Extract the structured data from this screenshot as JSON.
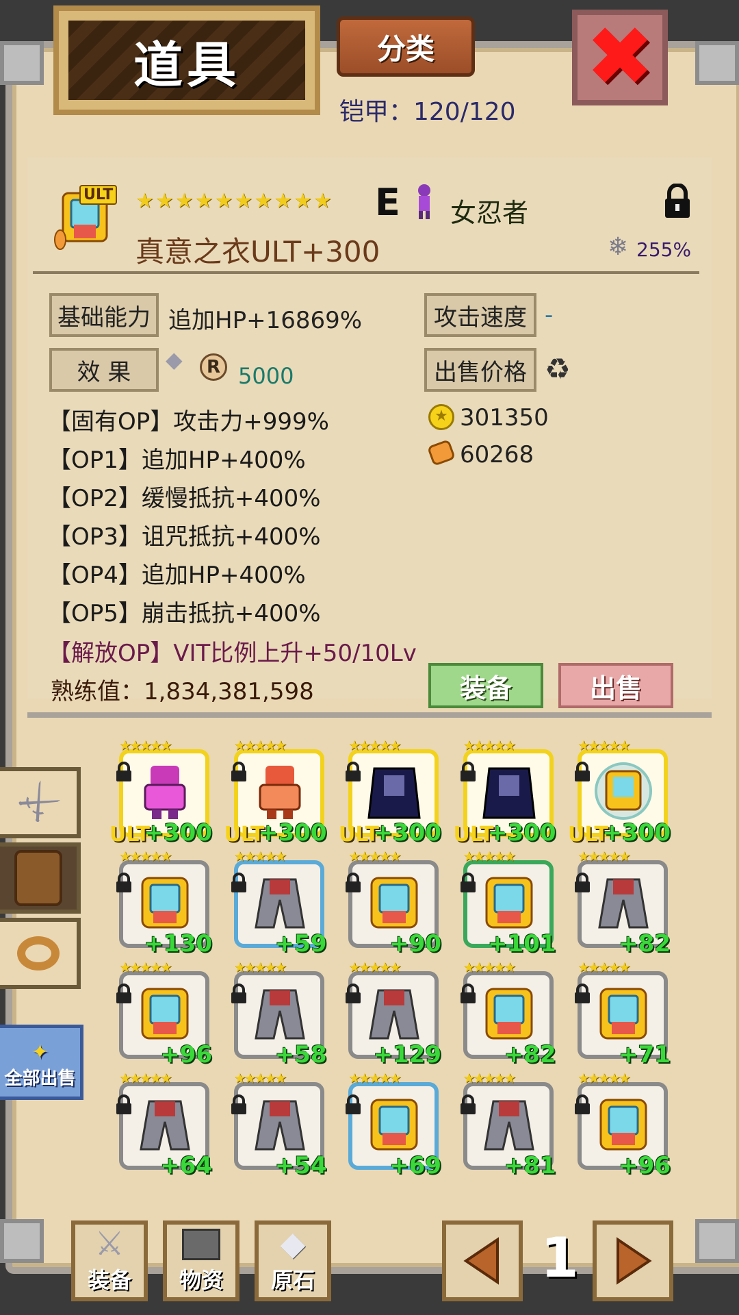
{
  "header": {
    "title": "道具",
    "category_button": "分类",
    "armor_count": "铠甲：120/120"
  },
  "item": {
    "ult_tag": "ULT",
    "stars": "★★★★★★★★★★",
    "grade": "E",
    "character": "女忍者",
    "name": "真意之衣ULT+300",
    "percent": "255%",
    "base_label": "基础能力",
    "base_value": "追加HP+16869%",
    "speed_label": "攻击速度",
    "speed_value": "-",
    "effect_label": "效 果",
    "r_value": "5000",
    "sell_label": "出售价格",
    "gold": "301350",
    "material": "60268",
    "options": [
      "【固有OP】攻击力+999%",
      "【OP1】追加HP+400%",
      "【OP2】缓慢抵抗+400%",
      "【OP3】诅咒抵抗+400%",
      "【OP4】追加HP+400%",
      "【OP5】崩击抵抗+400%"
    ],
    "liberation": "【解放OP】VIT比例上升+50/10Lv",
    "mastery": "熟练值：1,834,381,598"
  },
  "actions": {
    "equip": "装备",
    "sell": "出售"
  },
  "side": {
    "sell_all": "全部出售"
  },
  "grid": {
    "ult_label": "ULT",
    "star_text": "★★★★★",
    "levels": [
      "+300",
      "+300",
      "+300",
      "+300",
      "+300",
      "+130",
      "+59",
      "+90",
      "+101",
      "+82",
      "+96",
      "+58",
      "+129",
      "+82",
      "+71",
      "+64",
      "+54",
      "+69",
      "+81",
      "+96"
    ]
  },
  "bottom_nav": {
    "equip": "装备",
    "materials": "物资",
    "ore": "原石",
    "page": "1"
  },
  "colors": {
    "parchment": "#ead8b4",
    "level_green": "#3ad83a",
    "ult_gold": "#f7d21b"
  }
}
